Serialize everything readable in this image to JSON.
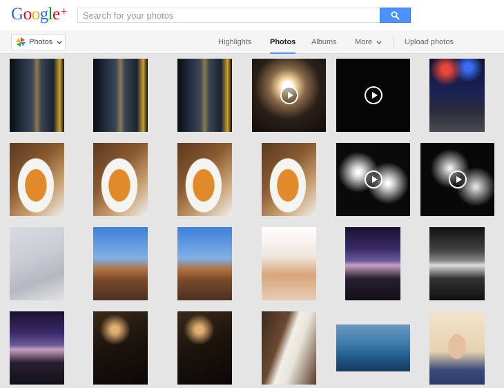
{
  "app": {
    "logo_text": "Google",
    "logo_suffix": "+"
  },
  "search": {
    "placeholder": "Search for your photos",
    "value": ""
  },
  "app_switcher": {
    "label": "Photos",
    "icon": "pinwheel-icon"
  },
  "nav": {
    "tabs": [
      {
        "label": "Highlights",
        "active": false
      },
      {
        "label": "Photos",
        "active": true
      },
      {
        "label": "Albums",
        "active": false
      },
      {
        "label": "More",
        "active": false
      }
    ],
    "upload_label": "Upload photos"
  },
  "colors": {
    "accent": "#4d90fe",
    "nav_bg": "#f5f5f5",
    "grid_bg": "#e5e5e5"
  },
  "photos": [
    {
      "kind": "corridor",
      "video": false
    },
    {
      "kind": "corridor",
      "video": false
    },
    {
      "kind": "corridor",
      "video": false
    },
    {
      "kind": "candle",
      "video": true
    },
    {
      "kind": "black",
      "video": true
    },
    {
      "kind": "stage",
      "video": false
    },
    {
      "kind": "soup",
      "video": false
    },
    {
      "kind": "soup",
      "video": false
    },
    {
      "kind": "soup",
      "video": false
    },
    {
      "kind": "soup",
      "video": false
    },
    {
      "kind": "fireworks",
      "video": true
    },
    {
      "kind": "fireworks-bw",
      "video": true
    },
    {
      "kind": "newspaper",
      "video": false
    },
    {
      "kind": "street",
      "video": false
    },
    {
      "kind": "street",
      "video": false
    },
    {
      "kind": "icecream",
      "video": false
    },
    {
      "kind": "christmas",
      "video": false
    },
    {
      "kind": "christmas-bw",
      "video": false
    },
    {
      "kind": "christmas",
      "video": false
    },
    {
      "kind": "stairs",
      "video": false
    },
    {
      "kind": "stairs",
      "video": false
    },
    {
      "kind": "guitar",
      "video": false
    },
    {
      "kind": "skyline",
      "video": false
    },
    {
      "kind": "portrait",
      "video": false
    }
  ]
}
